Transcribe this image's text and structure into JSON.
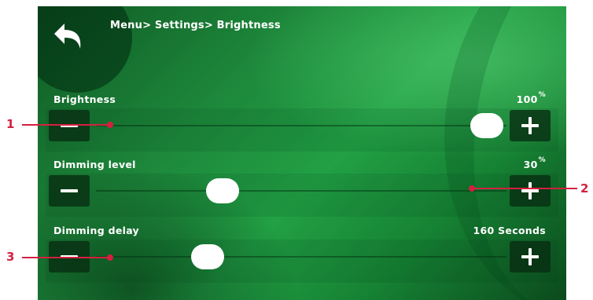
{
  "breadcrumb": "Menu> Settings> Brightness",
  "rows": [
    {
      "label": "Brightness",
      "value": "100",
      "unit": "%",
      "level_fraction": 1.0
    },
    {
      "label": "Dimming level",
      "value": "30",
      "unit": "%",
      "level_fraction": 0.3
    },
    {
      "label": "Dimming delay",
      "value": "160 Seconds",
      "unit": "",
      "level_fraction": 0.26
    }
  ],
  "callouts": {
    "one": "1",
    "two": "2",
    "three": "3"
  },
  "colors": {
    "callout": "#d4203f",
    "accent": "#22a045",
    "button": "#082d12"
  },
  "icons": {
    "back": "back-arrow-icon",
    "decrease": "minus-icon",
    "increase": "plus-icon"
  }
}
